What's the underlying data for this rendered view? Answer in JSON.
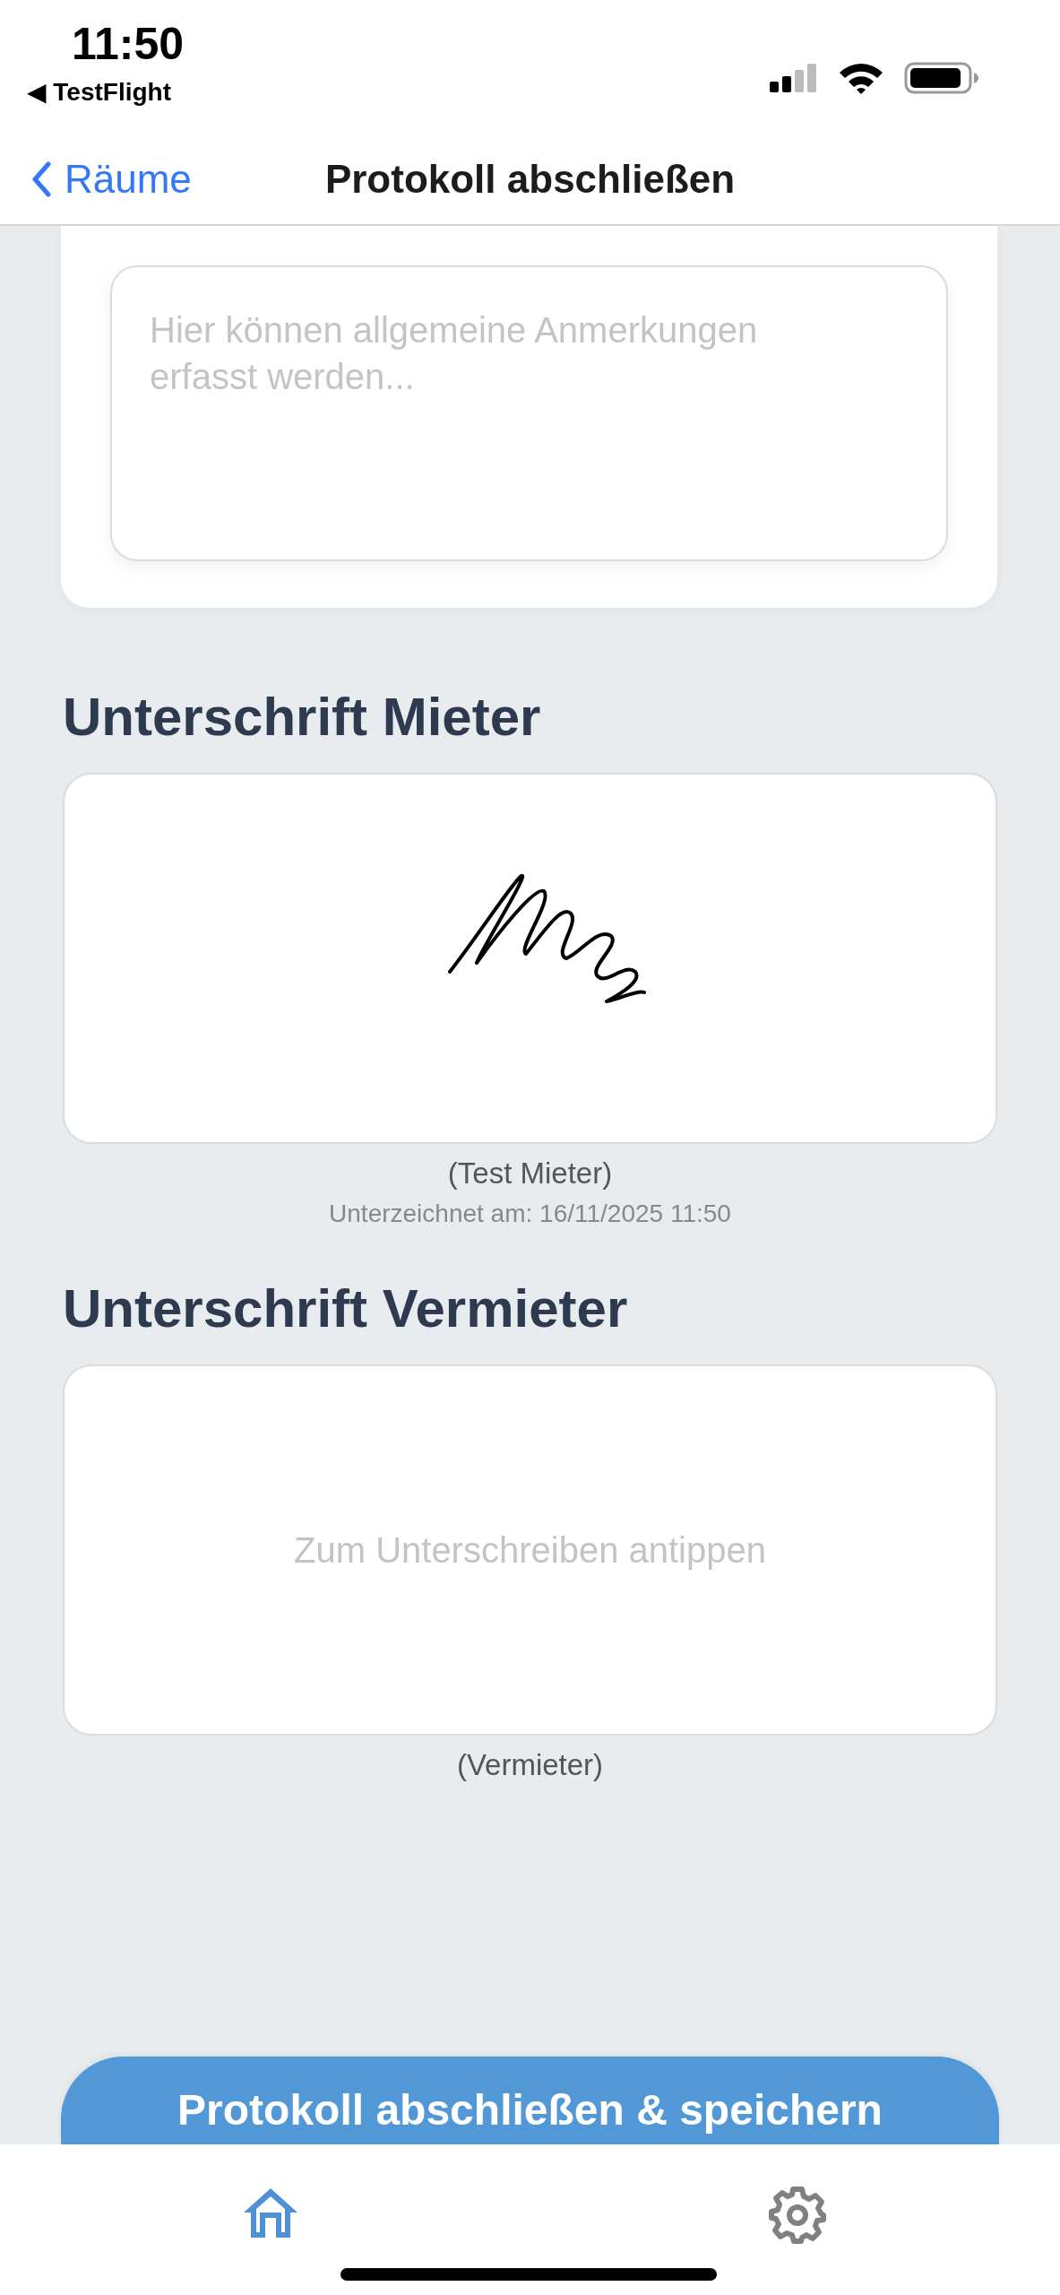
{
  "status_bar": {
    "time": "11:50",
    "back_app": "◀ TestFlight"
  },
  "nav_bar": {
    "back_label": "Räume",
    "title": "Protokoll abschließen"
  },
  "notes": {
    "placeholder": "Hier können allgemeine Anmerkungen erfasst werden..."
  },
  "signatures": [
    {
      "title": "Unterschrift Mieter",
      "kind": "signed",
      "name": "(Test Mieter)",
      "signed_at": "Unterzeichnet am: 16/11/2025 11:50"
    },
    {
      "title": "Unterschrift Vermieter",
      "kind": "empty",
      "placeholder": "Zum Unterschreiben antippen",
      "name": "(Vermieter)"
    }
  ],
  "submit_button": "Protokoll abschließen & speichern",
  "tab_bar": [
    {
      "kind": "home",
      "selected": true
    },
    {
      "kind": "settings",
      "selected": false
    }
  ]
}
